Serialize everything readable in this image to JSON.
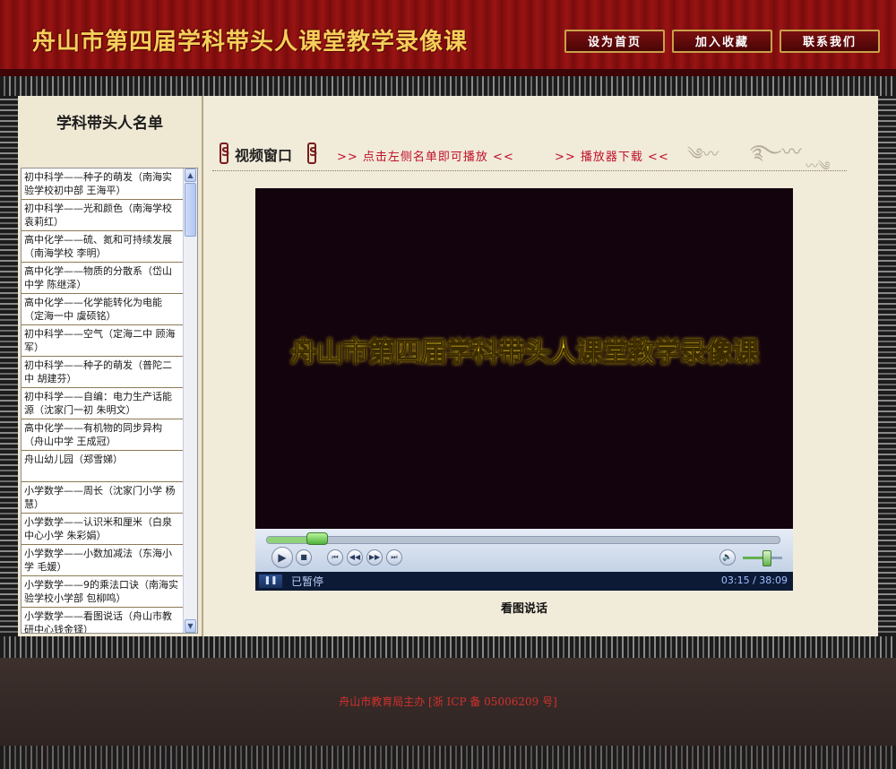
{
  "header": {
    "site_title": "舟山市第四届学科带头人课堂教学录像课",
    "buttons": [
      "设为首页",
      "加入收藏",
      "联系我们"
    ]
  },
  "sidebar": {
    "title": "学科带头人名单",
    "items": [
      "初中科学——种子的萌发（南海实验学校初中部 王海平）",
      "初中科学——光和颜色（南海学校 袁莉红）",
      "高中化学——硫、氮和可持续发展（南海学校 李明）",
      "高中化学——物质的分散系（岱山中学 陈继泽）",
      "高中化学——化学能转化为电能（定海一中 虞硕铭）",
      "初中科学——空气（定海二中 顾海军）",
      "初中科学——种子的萌发（普陀二中 胡建芬）",
      "初中科学——自编：电力生产话能源（沈家门一初 朱明文）",
      "高中化学——有机物的同步异构（舟山中学 王成冠）",
      "舟山幼儿园（郑雪娣）",
      "小学数学——周长（沈家门小学 杨慧）",
      "小学数学——认识米和厘米（白泉中心小学 朱彩娟）",
      "小学数学——小数加减法（东海小学 毛媛）",
      "小学数学——9的乘法口诀（南海实验学校小学部 包柳鸣）",
      "小学数学——看图说话（舟山市教研中心钱金铎）"
    ]
  },
  "main": {
    "video_window_title": "视频窗口",
    "play_hint": ">> 点击左侧名单即可播放 <<",
    "player_download": ">> 播放器下载 <<",
    "video_caption": "舟山市第四届学科带头人课堂教学录像课",
    "status": "已暂停",
    "time": "03:15 / 38:09",
    "now_title": "看图说话",
    "seek_progress": 0.085,
    "volume_level": 0.6
  },
  "footer": {
    "text": "舟山市教育局主办 [浙 ICP 备 05006209 号]"
  },
  "icons": {
    "play": "play-icon",
    "stop": "stop-icon",
    "prev": "previous-icon",
    "rewind": "rewind-icon",
    "forward": "fast-forward-icon",
    "next": "next-icon",
    "mute": "speaker-icon",
    "pause": "pause-icon"
  },
  "colors": {
    "header_red": "#8b1010",
    "title_gold": "#f4cf5a",
    "hint_red": "#c0102a",
    "caption_yellow": "#f2d21a",
    "footer_text": "#d0312d"
  }
}
